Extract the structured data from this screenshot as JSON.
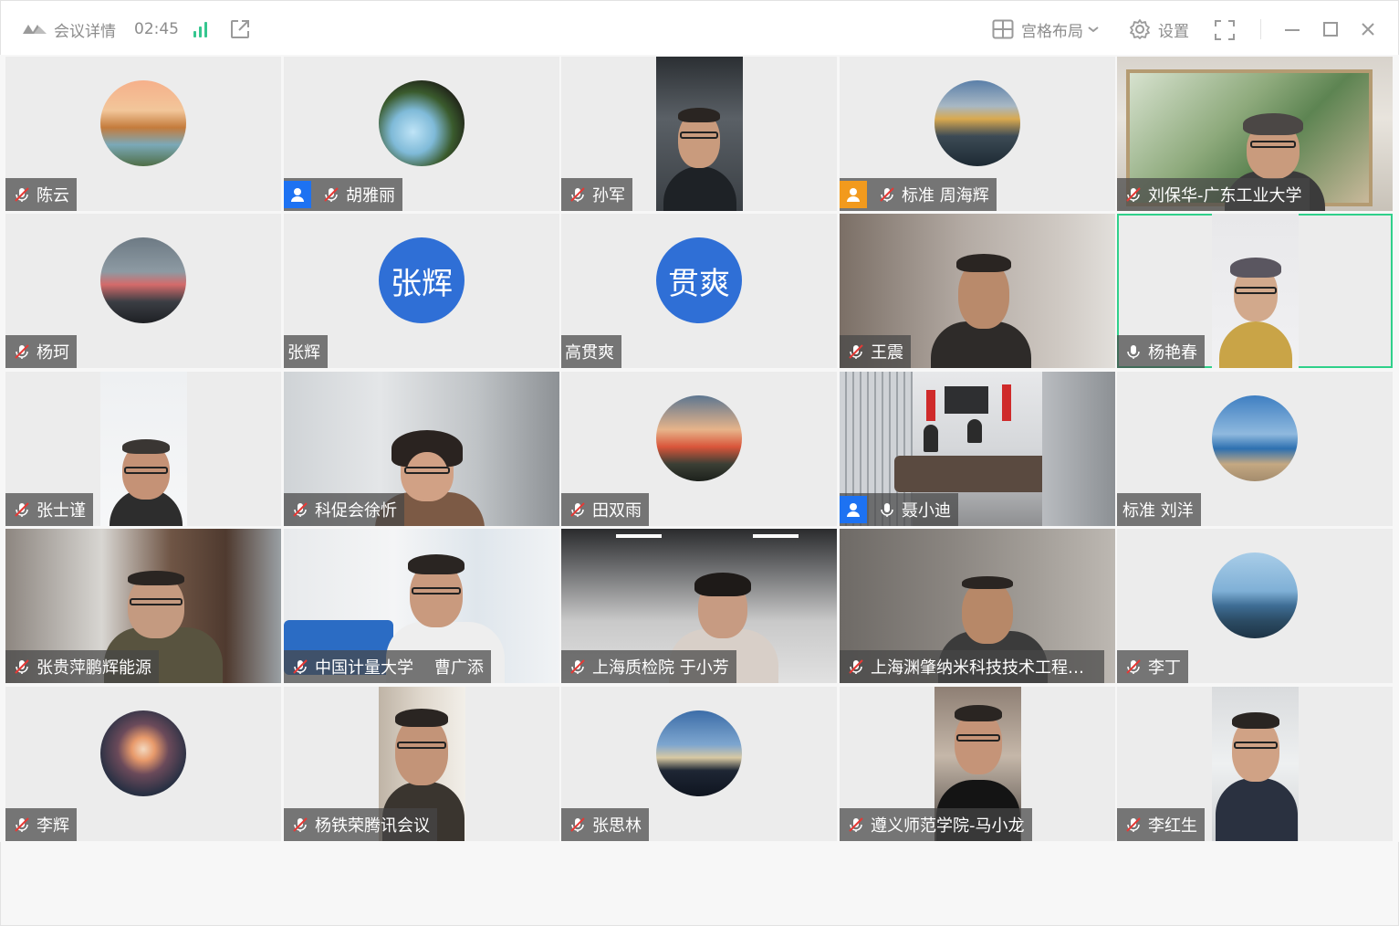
{
  "titlebar": {
    "title": "会议详情",
    "time": "02:45",
    "layout_label": "宫格布局",
    "settings_label": "设置",
    "accent": "#35c68f"
  },
  "participants": [
    {
      "name": "陈云",
      "kind": "avatar",
      "muted": true
    },
    {
      "name": "胡雅丽",
      "kind": "avatar",
      "muted": true,
      "badge": "blue"
    },
    {
      "name": "孙军",
      "kind": "video",
      "muted": true
    },
    {
      "name": "标准  周海辉",
      "kind": "avatar",
      "muted": true,
      "badge": "orange"
    },
    {
      "name": "刘保华-广东工业大学",
      "kind": "video",
      "muted": true
    },
    {
      "name": "杨珂",
      "kind": "avatar",
      "muted": true
    },
    {
      "name": "张辉",
      "kind": "text-avatar",
      "avatar_text": "张辉",
      "muted": false
    },
    {
      "name": "高贯爽",
      "kind": "text-avatar",
      "avatar_text": "贯爽",
      "muted": false
    },
    {
      "name": "王震",
      "kind": "video",
      "muted": true
    },
    {
      "name": "杨艳春",
      "kind": "video",
      "muted": false,
      "speaking": true
    },
    {
      "name": "张士谨",
      "kind": "video",
      "muted": true
    },
    {
      "name": "科促会徐忻",
      "kind": "video",
      "muted": true
    },
    {
      "name": "田双雨",
      "kind": "avatar",
      "muted": true
    },
    {
      "name": "聂小迪",
      "kind": "video",
      "muted": false,
      "badge": "blue"
    },
    {
      "name": "标准 刘洋",
      "kind": "avatar",
      "muted": false
    },
    {
      "name": "张贵萍鹏辉能源",
      "kind": "video",
      "muted": true
    },
    {
      "name": "中国计量大学    曹广添",
      "kind": "video",
      "muted": true
    },
    {
      "name": "上海质检院 于小芳",
      "kind": "video",
      "muted": true
    },
    {
      "name": "上海渊肇纳米科技技术工程师...",
      "kind": "video",
      "muted": true
    },
    {
      "name": "李丁",
      "kind": "avatar",
      "muted": true
    },
    {
      "name": "李辉",
      "kind": "avatar",
      "muted": true
    },
    {
      "name": "杨铁荣腾讯会议",
      "kind": "video",
      "muted": true
    },
    {
      "name": "张思林",
      "kind": "avatar",
      "muted": true
    },
    {
      "name": "遵义师范学院-马小龙",
      "kind": "video",
      "muted": true
    },
    {
      "name": "李红生",
      "kind": "video",
      "muted": true
    }
  ]
}
